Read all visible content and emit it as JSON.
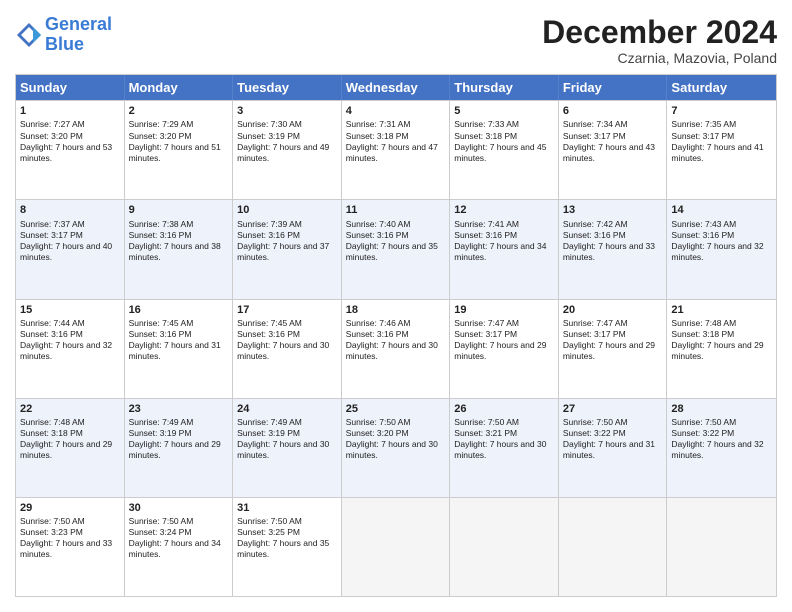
{
  "header": {
    "logo_line1": "General",
    "logo_line2": "Blue",
    "month": "December 2024",
    "location": "Czarnia, Mazovia, Poland"
  },
  "days_of_week": [
    "Sunday",
    "Monday",
    "Tuesday",
    "Wednesday",
    "Thursday",
    "Friday",
    "Saturday"
  ],
  "weeks": [
    [
      {
        "day": "1",
        "sunrise": "Sunrise: 7:27 AM",
        "sunset": "Sunset: 3:20 PM",
        "daylight": "Daylight: 7 hours and 53 minutes."
      },
      {
        "day": "2",
        "sunrise": "Sunrise: 7:29 AM",
        "sunset": "Sunset: 3:20 PM",
        "daylight": "Daylight: 7 hours and 51 minutes."
      },
      {
        "day": "3",
        "sunrise": "Sunrise: 7:30 AM",
        "sunset": "Sunset: 3:19 PM",
        "daylight": "Daylight: 7 hours and 49 minutes."
      },
      {
        "day": "4",
        "sunrise": "Sunrise: 7:31 AM",
        "sunset": "Sunset: 3:18 PM",
        "daylight": "Daylight: 7 hours and 47 minutes."
      },
      {
        "day": "5",
        "sunrise": "Sunrise: 7:33 AM",
        "sunset": "Sunset: 3:18 PM",
        "daylight": "Daylight: 7 hours and 45 minutes."
      },
      {
        "day": "6",
        "sunrise": "Sunrise: 7:34 AM",
        "sunset": "Sunset: 3:17 PM",
        "daylight": "Daylight: 7 hours and 43 minutes."
      },
      {
        "day": "7",
        "sunrise": "Sunrise: 7:35 AM",
        "sunset": "Sunset: 3:17 PM",
        "daylight": "Daylight: 7 hours and 41 minutes."
      }
    ],
    [
      {
        "day": "8",
        "sunrise": "Sunrise: 7:37 AM",
        "sunset": "Sunset: 3:17 PM",
        "daylight": "Daylight: 7 hours and 40 minutes."
      },
      {
        "day": "9",
        "sunrise": "Sunrise: 7:38 AM",
        "sunset": "Sunset: 3:16 PM",
        "daylight": "Daylight: 7 hours and 38 minutes."
      },
      {
        "day": "10",
        "sunrise": "Sunrise: 7:39 AM",
        "sunset": "Sunset: 3:16 PM",
        "daylight": "Daylight: 7 hours and 37 minutes."
      },
      {
        "day": "11",
        "sunrise": "Sunrise: 7:40 AM",
        "sunset": "Sunset: 3:16 PM",
        "daylight": "Daylight: 7 hours and 35 minutes."
      },
      {
        "day": "12",
        "sunrise": "Sunrise: 7:41 AM",
        "sunset": "Sunset: 3:16 PM",
        "daylight": "Daylight: 7 hours and 34 minutes."
      },
      {
        "day": "13",
        "sunrise": "Sunrise: 7:42 AM",
        "sunset": "Sunset: 3:16 PM",
        "daylight": "Daylight: 7 hours and 33 minutes."
      },
      {
        "day": "14",
        "sunrise": "Sunrise: 7:43 AM",
        "sunset": "Sunset: 3:16 PM",
        "daylight": "Daylight: 7 hours and 32 minutes."
      }
    ],
    [
      {
        "day": "15",
        "sunrise": "Sunrise: 7:44 AM",
        "sunset": "Sunset: 3:16 PM",
        "daylight": "Daylight: 7 hours and 32 minutes."
      },
      {
        "day": "16",
        "sunrise": "Sunrise: 7:45 AM",
        "sunset": "Sunset: 3:16 PM",
        "daylight": "Daylight: 7 hours and 31 minutes."
      },
      {
        "day": "17",
        "sunrise": "Sunrise: 7:45 AM",
        "sunset": "Sunset: 3:16 PM",
        "daylight": "Daylight: 7 hours and 30 minutes."
      },
      {
        "day": "18",
        "sunrise": "Sunrise: 7:46 AM",
        "sunset": "Sunset: 3:16 PM",
        "daylight": "Daylight: 7 hours and 30 minutes."
      },
      {
        "day": "19",
        "sunrise": "Sunrise: 7:47 AM",
        "sunset": "Sunset: 3:17 PM",
        "daylight": "Daylight: 7 hours and 29 minutes."
      },
      {
        "day": "20",
        "sunrise": "Sunrise: 7:47 AM",
        "sunset": "Sunset: 3:17 PM",
        "daylight": "Daylight: 7 hours and 29 minutes."
      },
      {
        "day": "21",
        "sunrise": "Sunrise: 7:48 AM",
        "sunset": "Sunset: 3:18 PM",
        "daylight": "Daylight: 7 hours and 29 minutes."
      }
    ],
    [
      {
        "day": "22",
        "sunrise": "Sunrise: 7:48 AM",
        "sunset": "Sunset: 3:18 PM",
        "daylight": "Daylight: 7 hours and 29 minutes."
      },
      {
        "day": "23",
        "sunrise": "Sunrise: 7:49 AM",
        "sunset": "Sunset: 3:19 PM",
        "daylight": "Daylight: 7 hours and 29 minutes."
      },
      {
        "day": "24",
        "sunrise": "Sunrise: 7:49 AM",
        "sunset": "Sunset: 3:19 PM",
        "daylight": "Daylight: 7 hours and 30 minutes."
      },
      {
        "day": "25",
        "sunrise": "Sunrise: 7:50 AM",
        "sunset": "Sunset: 3:20 PM",
        "daylight": "Daylight: 7 hours and 30 minutes."
      },
      {
        "day": "26",
        "sunrise": "Sunrise: 7:50 AM",
        "sunset": "Sunset: 3:21 PM",
        "daylight": "Daylight: 7 hours and 30 minutes."
      },
      {
        "day": "27",
        "sunrise": "Sunrise: 7:50 AM",
        "sunset": "Sunset: 3:22 PM",
        "daylight": "Daylight: 7 hours and 31 minutes."
      },
      {
        "day": "28",
        "sunrise": "Sunrise: 7:50 AM",
        "sunset": "Sunset: 3:22 PM",
        "daylight": "Daylight: 7 hours and 32 minutes."
      }
    ],
    [
      {
        "day": "29",
        "sunrise": "Sunrise: 7:50 AM",
        "sunset": "Sunset: 3:23 PM",
        "daylight": "Daylight: 7 hours and 33 minutes."
      },
      {
        "day": "30",
        "sunrise": "Sunrise: 7:50 AM",
        "sunset": "Sunset: 3:24 PM",
        "daylight": "Daylight: 7 hours and 34 minutes."
      },
      {
        "day": "31",
        "sunrise": "Sunrise: 7:50 AM",
        "sunset": "Sunset: 3:25 PM",
        "daylight": "Daylight: 7 hours and 35 minutes."
      },
      null,
      null,
      null,
      null
    ]
  ]
}
